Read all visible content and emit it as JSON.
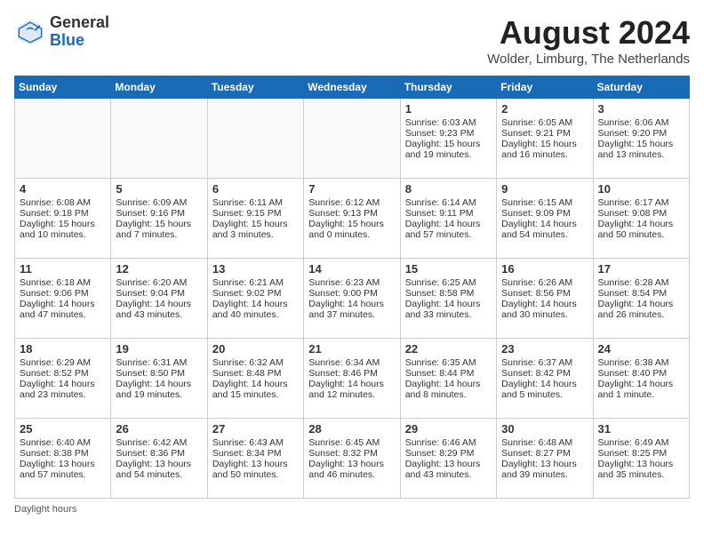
{
  "header": {
    "logo_general": "General",
    "logo_blue": "Blue",
    "month_title": "August 2024",
    "location": "Wolder, Limburg, The Netherlands"
  },
  "days_of_week": [
    "Sunday",
    "Monday",
    "Tuesday",
    "Wednesday",
    "Thursday",
    "Friday",
    "Saturday"
  ],
  "footer": {
    "note": "Daylight hours"
  },
  "weeks": [
    [
      {
        "day": "",
        "sunrise": "",
        "sunset": "",
        "daylight": ""
      },
      {
        "day": "",
        "sunrise": "",
        "sunset": "",
        "daylight": ""
      },
      {
        "day": "",
        "sunrise": "",
        "sunset": "",
        "daylight": ""
      },
      {
        "day": "",
        "sunrise": "",
        "sunset": "",
        "daylight": ""
      },
      {
        "day": "1",
        "sunrise": "Sunrise: 6:03 AM",
        "sunset": "Sunset: 9:23 PM",
        "daylight": "Daylight: 15 hours and 19 minutes."
      },
      {
        "day": "2",
        "sunrise": "Sunrise: 6:05 AM",
        "sunset": "Sunset: 9:21 PM",
        "daylight": "Daylight: 15 hours and 16 minutes."
      },
      {
        "day": "3",
        "sunrise": "Sunrise: 6:06 AM",
        "sunset": "Sunset: 9:20 PM",
        "daylight": "Daylight: 15 hours and 13 minutes."
      }
    ],
    [
      {
        "day": "4",
        "sunrise": "Sunrise: 6:08 AM",
        "sunset": "Sunset: 9:18 PM",
        "daylight": "Daylight: 15 hours and 10 minutes."
      },
      {
        "day": "5",
        "sunrise": "Sunrise: 6:09 AM",
        "sunset": "Sunset: 9:16 PM",
        "daylight": "Daylight: 15 hours and 7 minutes."
      },
      {
        "day": "6",
        "sunrise": "Sunrise: 6:11 AM",
        "sunset": "Sunset: 9:15 PM",
        "daylight": "Daylight: 15 hours and 3 minutes."
      },
      {
        "day": "7",
        "sunrise": "Sunrise: 6:12 AM",
        "sunset": "Sunset: 9:13 PM",
        "daylight": "Daylight: 15 hours and 0 minutes."
      },
      {
        "day": "8",
        "sunrise": "Sunrise: 6:14 AM",
        "sunset": "Sunset: 9:11 PM",
        "daylight": "Daylight: 14 hours and 57 minutes."
      },
      {
        "day": "9",
        "sunrise": "Sunrise: 6:15 AM",
        "sunset": "Sunset: 9:09 PM",
        "daylight": "Daylight: 14 hours and 54 minutes."
      },
      {
        "day": "10",
        "sunrise": "Sunrise: 6:17 AM",
        "sunset": "Sunset: 9:08 PM",
        "daylight": "Daylight: 14 hours and 50 minutes."
      }
    ],
    [
      {
        "day": "11",
        "sunrise": "Sunrise: 6:18 AM",
        "sunset": "Sunset: 9:06 PM",
        "daylight": "Daylight: 14 hours and 47 minutes."
      },
      {
        "day": "12",
        "sunrise": "Sunrise: 6:20 AM",
        "sunset": "Sunset: 9:04 PM",
        "daylight": "Daylight: 14 hours and 43 minutes."
      },
      {
        "day": "13",
        "sunrise": "Sunrise: 6:21 AM",
        "sunset": "Sunset: 9:02 PM",
        "daylight": "Daylight: 14 hours and 40 minutes."
      },
      {
        "day": "14",
        "sunrise": "Sunrise: 6:23 AM",
        "sunset": "Sunset: 9:00 PM",
        "daylight": "Daylight: 14 hours and 37 minutes."
      },
      {
        "day": "15",
        "sunrise": "Sunrise: 6:25 AM",
        "sunset": "Sunset: 8:58 PM",
        "daylight": "Daylight: 14 hours and 33 minutes."
      },
      {
        "day": "16",
        "sunrise": "Sunrise: 6:26 AM",
        "sunset": "Sunset: 8:56 PM",
        "daylight": "Daylight: 14 hours and 30 minutes."
      },
      {
        "day": "17",
        "sunrise": "Sunrise: 6:28 AM",
        "sunset": "Sunset: 8:54 PM",
        "daylight": "Daylight: 14 hours and 26 minutes."
      }
    ],
    [
      {
        "day": "18",
        "sunrise": "Sunrise: 6:29 AM",
        "sunset": "Sunset: 8:52 PM",
        "daylight": "Daylight: 14 hours and 23 minutes."
      },
      {
        "day": "19",
        "sunrise": "Sunrise: 6:31 AM",
        "sunset": "Sunset: 8:50 PM",
        "daylight": "Daylight: 14 hours and 19 minutes."
      },
      {
        "day": "20",
        "sunrise": "Sunrise: 6:32 AM",
        "sunset": "Sunset: 8:48 PM",
        "daylight": "Daylight: 14 hours and 15 minutes."
      },
      {
        "day": "21",
        "sunrise": "Sunrise: 6:34 AM",
        "sunset": "Sunset: 8:46 PM",
        "daylight": "Daylight: 14 hours and 12 minutes."
      },
      {
        "day": "22",
        "sunrise": "Sunrise: 6:35 AM",
        "sunset": "Sunset: 8:44 PM",
        "daylight": "Daylight: 14 hours and 8 minutes."
      },
      {
        "day": "23",
        "sunrise": "Sunrise: 6:37 AM",
        "sunset": "Sunset: 8:42 PM",
        "daylight": "Daylight: 14 hours and 5 minutes."
      },
      {
        "day": "24",
        "sunrise": "Sunrise: 6:38 AM",
        "sunset": "Sunset: 8:40 PM",
        "daylight": "Daylight: 14 hours and 1 minute."
      }
    ],
    [
      {
        "day": "25",
        "sunrise": "Sunrise: 6:40 AM",
        "sunset": "Sunset: 8:38 PM",
        "daylight": "Daylight: 13 hours and 57 minutes."
      },
      {
        "day": "26",
        "sunrise": "Sunrise: 6:42 AM",
        "sunset": "Sunset: 8:36 PM",
        "daylight": "Daylight: 13 hours and 54 minutes."
      },
      {
        "day": "27",
        "sunrise": "Sunrise: 6:43 AM",
        "sunset": "Sunset: 8:34 PM",
        "daylight": "Daylight: 13 hours and 50 minutes."
      },
      {
        "day": "28",
        "sunrise": "Sunrise: 6:45 AM",
        "sunset": "Sunset: 8:32 PM",
        "daylight": "Daylight: 13 hours and 46 minutes."
      },
      {
        "day": "29",
        "sunrise": "Sunrise: 6:46 AM",
        "sunset": "Sunset: 8:29 PM",
        "daylight": "Daylight: 13 hours and 43 minutes."
      },
      {
        "day": "30",
        "sunrise": "Sunrise: 6:48 AM",
        "sunset": "Sunset: 8:27 PM",
        "daylight": "Daylight: 13 hours and 39 minutes."
      },
      {
        "day": "31",
        "sunrise": "Sunrise: 6:49 AM",
        "sunset": "Sunset: 8:25 PM",
        "daylight": "Daylight: 13 hours and 35 minutes."
      }
    ]
  ]
}
